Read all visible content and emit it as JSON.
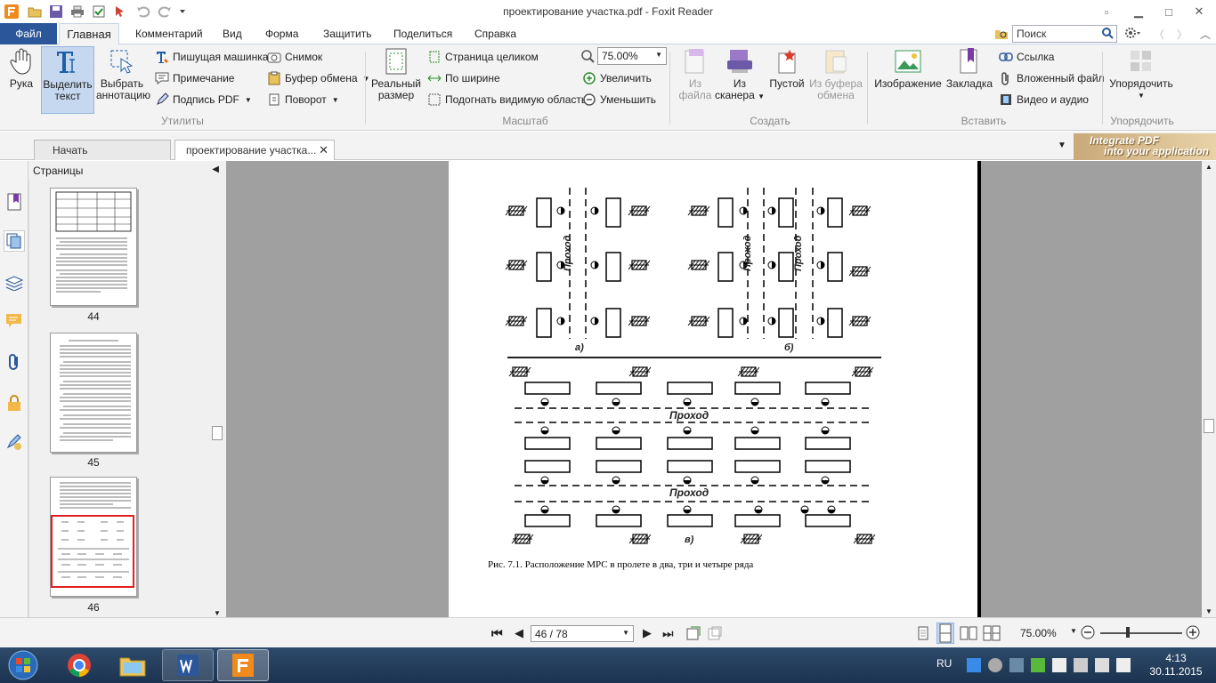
{
  "window": {
    "title": "проектирование участка.pdf - Foxit Reader"
  },
  "ribbon_tabs": {
    "file": "Файл",
    "home": "Главная",
    "comment": "Комментарий",
    "view": "Вид",
    "form": "Форма",
    "protect": "Защитить",
    "share": "Поделиться",
    "help": "Справка"
  },
  "search": {
    "placeholder": "Поиск"
  },
  "tools": {
    "hand": "Рука",
    "select_text_1": "Выделить",
    "select_text_2": "текст",
    "select_annot_1": "Выбрать",
    "select_annot_2": "аннотацию",
    "typewriter": "Пишущая машинка",
    "note": "Примечание",
    "sign": "Подпись PDF",
    "snapshot": "Снимок",
    "clipboard": "Буфер обмена",
    "rotate": "Поворот",
    "group": "Утилиты"
  },
  "zoom": {
    "actual_1": "Реальный",
    "actual_2": "размер",
    "fit_page": "Страница целиком",
    "fit_width": "По ширине",
    "fit_visible": "Подогнать видимую область",
    "zoom_value": "75.00%",
    "zoom_in": "Увеличить",
    "zoom_out": "Уменьшить",
    "group": "Масштаб"
  },
  "create": {
    "from_file_1": "Из",
    "from_file_2": "файла",
    "from_scanner_1": "Из",
    "from_scanner_2": "сканера",
    "blank": "Пустой",
    "from_clip_1": "Из буфера",
    "from_clip_2": "обмена",
    "group": "Создать"
  },
  "insert": {
    "image": "Изображение",
    "bookmark": "Закладка",
    "link": "Ссылка",
    "attachment": "Вложенный файл",
    "video": "Видео и аудио",
    "group": "Вставить"
  },
  "arrange": {
    "label": "Упорядочить",
    "group": "Упорядочить"
  },
  "doc_tabs": {
    "start": "Начать",
    "current": "проектирование участка..."
  },
  "banner": {
    "line1": "Integrate PDF",
    "line2": "into your application"
  },
  "pages_panel": {
    "title": "Страницы",
    "pages": [
      "44",
      "45",
      "46"
    ]
  },
  "document": {
    "caption": "Рис. 7.1. Расположение МРС в пролете в два, три и четыре ряда",
    "aisle": "Проход",
    "label_a": "а)",
    "label_b": "б)",
    "label_c": "в)"
  },
  "status": {
    "page_field": "46 / 78",
    "zoom": "75.00%"
  },
  "taskbar": {
    "lang": "RU",
    "time": "4:13",
    "date": "30.11.2015"
  }
}
